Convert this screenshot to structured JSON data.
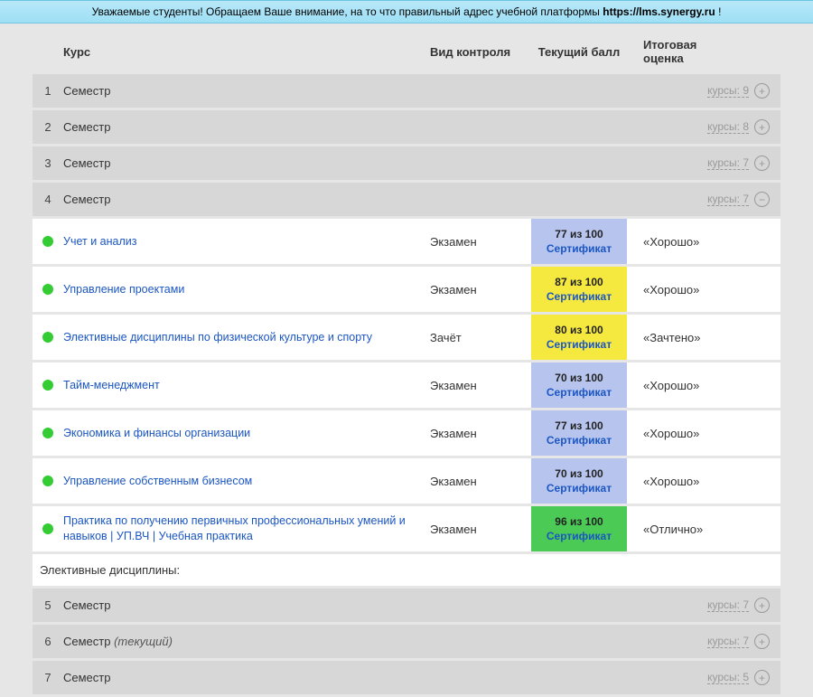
{
  "banner": {
    "pre": "Уважаемые студенты! Обращаем Ваше внимание, на то что правильный адрес учебной платформы ",
    "url": "https://lms.synergy.ru",
    "post": " !"
  },
  "headers": {
    "course": "Курс",
    "control": "Вид контроля",
    "score": "Текущий балл",
    "grade": "Итоговая оценка"
  },
  "sem_word": "Семестр",
  "current_word": "(текущий)",
  "courses_word": "курсы:",
  "cert_word": "Сертификат",
  "score_word": "из 100",
  "elective_label": "Элективные дисциплины:",
  "top_semesters": [
    {
      "num": "1",
      "count": "9",
      "expanded": false
    },
    {
      "num": "2",
      "count": "8",
      "expanded": false
    },
    {
      "num": "3",
      "count": "7",
      "expanded": false
    },
    {
      "num": "4",
      "count": "7",
      "expanded": true
    }
  ],
  "courses": [
    {
      "name": "Учет и анализ",
      "control": "Экзамен",
      "score": "77",
      "color": "blue",
      "grade": "«Хорошо»"
    },
    {
      "name": "Управление проектами",
      "control": "Экзамен",
      "score": "87",
      "color": "yellow",
      "grade": "«Хорошо»"
    },
    {
      "name": "Элективные дисциплины по физической культуре и спорту",
      "control": "Зачёт",
      "score": "80",
      "color": "yellow",
      "grade": "«Зачтено»"
    },
    {
      "name": "Тайм-менеджмент",
      "control": "Экзамен",
      "score": "70",
      "color": "blue",
      "grade": "«Хорошо»"
    },
    {
      "name": "Экономика и финансы организации",
      "control": "Экзамен",
      "score": "77",
      "color": "blue",
      "grade": "«Хорошо»"
    },
    {
      "name": "Управление собственным бизнесом",
      "control": "Экзамен",
      "score": "70",
      "color": "blue",
      "grade": "«Хорошо»"
    },
    {
      "name": "Практика по получению первичных профессиональных умений и навыков | УП.ВЧ | Учебная практика",
      "control": "Экзамен",
      "score": "96",
      "color": "green",
      "grade": "«Отлично»"
    }
  ],
  "bottom_semesters": [
    {
      "num": "5",
      "count": "7",
      "current": false
    },
    {
      "num": "6",
      "count": "7",
      "current": true
    },
    {
      "num": "7",
      "count": "5",
      "current": false
    }
  ]
}
